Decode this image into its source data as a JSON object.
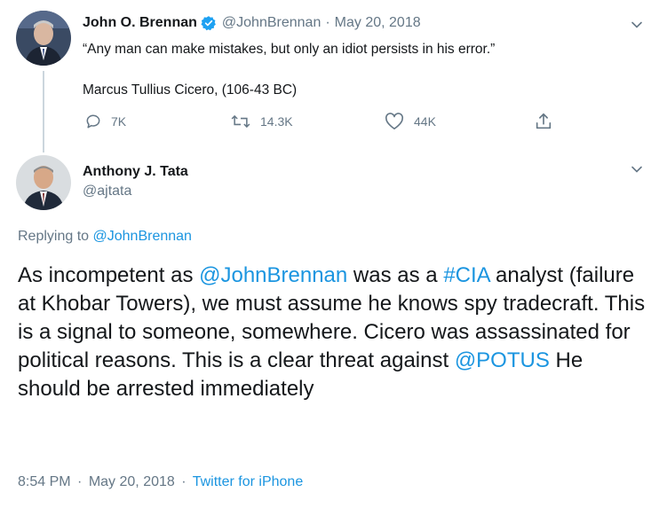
{
  "original_tweet": {
    "author_name": "John O. Brennan",
    "handle": "@JohnBrennan",
    "separator": "·",
    "date": "May 20, 2018",
    "quote": "“Any man can make mistakes, but only an idiot persists in his error.”",
    "attribution": "Marcus Tullius Cicero, (106-43 BC)",
    "actions": {
      "reply_count": "7K",
      "retweet_count": "14.3K",
      "like_count": "44K"
    }
  },
  "reply_tweet": {
    "author_name": "Anthony J. Tata",
    "handle": "@ajtata",
    "replying_prefix": "Replying to",
    "replying_to": "@JohnBrennan",
    "text": {
      "p1": "As incompetent as ",
      "m1": "@JohnBrennan",
      "p2": " was as a ",
      "m2": "#CIA",
      "p3": " analyst (failure at Khobar Towers), we must assume he knows spy tradecraft. This is a signal to someone, somewhere. Cicero was assassinated for political reasons. This is a clear threat against ",
      "m3": "@POTUS",
      "p4": " He should be arrested immediately"
    },
    "time": "8:54 PM",
    "separator": "·",
    "date": "May 20, 2018",
    "source": "Twitter for iPhone"
  },
  "icons": {
    "verified": "verified-badge-icon",
    "chevron": "chevron-down-icon",
    "reply": "reply-icon",
    "retweet": "retweet-icon",
    "like": "heart-icon",
    "share": "share-icon"
  },
  "colors": {
    "link": "#1b95e0",
    "secondary_text": "#657786",
    "verified": "#1da1f2"
  }
}
